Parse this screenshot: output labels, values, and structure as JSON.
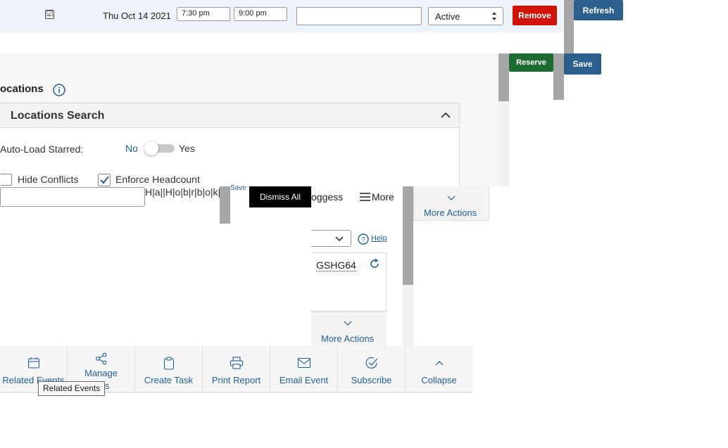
{
  "top_row": {
    "checkbox_mark": "☑",
    "date": "Thu Oct 14 2021",
    "start_time": "7:30 pm",
    "end_time": "9:00 pm",
    "notes_value": "",
    "status_value": "Active",
    "remove_label": "Remove",
    "refresh_label": "Refresh"
  },
  "actions": {
    "reserve_label": "Reserve",
    "save_label": "Save"
  },
  "locations": {
    "heading": "ocations",
    "search_title": "Locations Search",
    "auto_load_label": "Auto-Load Starred:",
    "toggle_no": "No",
    "toggle_yes": "Yes",
    "hide_conflicts_label": "Hide Conflicts",
    "enforce_headcount_label": "Enforce Headcount"
  },
  "overlay": {
    "search_value": "",
    "garbled_text": "H|a||H|o|b|r|b|o|k||J|r|",
    "save_small": "Save",
    "dismiss_all_label": "Dismiss All",
    "user_text": "oggess",
    "more_label": "More",
    "more_actions_label": "More Actions",
    "help_label": "Help",
    "code": "GSHG64"
  },
  "bottom_bar": {
    "items": [
      {
        "label": "Related Events",
        "icon": "calendar-icon"
      },
      {
        "label": "Manage Bindings",
        "icon": "share-icon"
      },
      {
        "label": "Create Task",
        "icon": "clipboard-icon"
      },
      {
        "label": "Print Report",
        "icon": "printer-icon"
      },
      {
        "label": "Email Event",
        "icon": "envelope-icon"
      },
      {
        "label": "Subscribe",
        "icon": "check-circle-icon"
      },
      {
        "label": "Collapse",
        "icon": "chevron-up-icon"
      }
    ],
    "tooltip": "Related Events",
    "manage_line1": "Manage",
    "manage_line2": "ings"
  },
  "colors": {
    "link_blue": "#1f5f99",
    "remove_red": "#d0140a",
    "reserve_green": "#1e6b33",
    "save_blue": "#2b5f8d",
    "dark_bg": "#000000"
  }
}
